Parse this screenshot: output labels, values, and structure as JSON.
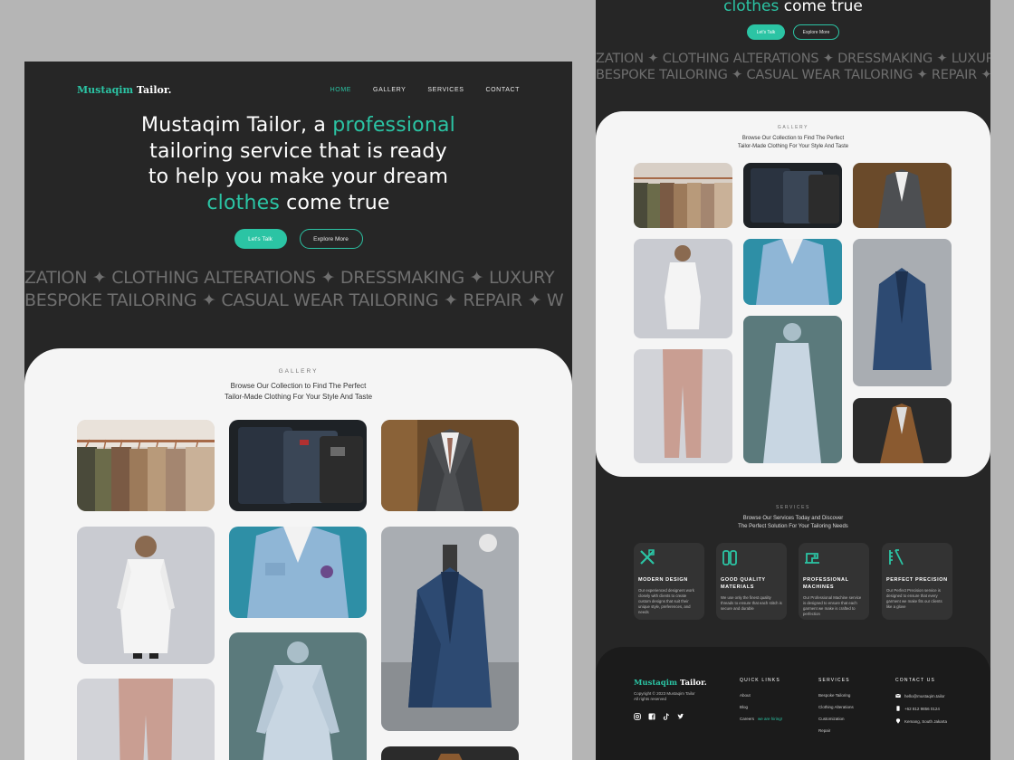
{
  "brand": {
    "name_accent": "Mustaqim",
    "name_rest": " Tailor."
  },
  "nav": {
    "home": "HOME",
    "gallery": "GALLERY",
    "services": "SERVICES",
    "contact": "CONTACT"
  },
  "hero": {
    "line1_a": "Mustaqim Tailor, a ",
    "line1_b": "professional",
    "line2": "tailoring service that is ready",
    "line3": "to help you make your dream",
    "line4_a": "clothes",
    "line4_b": " come true",
    "cta_primary": "Let's Talk",
    "cta_secondary": "Explore More"
  },
  "marquee": {
    "row1": "ZATION ✦ CLOTHING ALTERATIONS ✦ DRESSMAKING ✦ LUXURY",
    "row2": "BESPOKE TAILORING ✦ CASUAL WEAR TAILORING ✦ REPAIR ✦ W"
  },
  "gallery": {
    "label": "GALLERY",
    "subtitle_1": "Browse Our Collection to Find The Perfect",
    "subtitle_2": "Tailor-Made Clothing For Your Style And Taste"
  },
  "services": {
    "label": "SERVICES",
    "subtitle_1": "Browse Our Services Today and Discover",
    "subtitle_2": "The Perfect Solution For Your Tailoring Needs",
    "cards": [
      {
        "icon": "design-tools-icon",
        "title": "MODERN DESIGN",
        "desc": "Our experienced designers work closely with clients to create custom designs that suit their unique style, preferences, and needs"
      },
      {
        "icon": "fabric-icon",
        "title": "GOOD QUALITY MATERIALS",
        "desc": "We use only the finest quality threads to ensure that each stitch is secure and durable"
      },
      {
        "icon": "sewing-machine-icon",
        "title": "PROFESSIONAL MACHINES",
        "desc": "Our Professional Machine service is designed to ensure that each garment we make is crafted to perfection"
      },
      {
        "icon": "measure-icon",
        "title": "PERFECT PRECISION",
        "desc": "Our Perfect Precision service is designed to ensure that every garment we make fits our clients like a glove"
      }
    ]
  },
  "footer": {
    "copyright_1": "Copyright © 2023 Mustaqim Tailor",
    "copyright_2": "All rights reserved",
    "quick_links": {
      "title": "QUICK LINKS",
      "items": [
        "About",
        "Blog",
        "Careers"
      ],
      "careers_tag": "we are hiring!"
    },
    "services": {
      "title": "SERVICES",
      "items": [
        "Bespoke Tailoring",
        "Clothing Alterations",
        "Customization",
        "Repair"
      ]
    },
    "contact": {
      "title": "CONTACT US",
      "email": "hello@mustaqim.tailor",
      "phone": "+62 812 9856 0124",
      "address": "Kemang, South Jakarta"
    }
  },
  "colors": {
    "accent": "#2bc4a4",
    "dark": "#262626",
    "panel": "#f5f5f5",
    "backdrop": "#b5b5b5"
  }
}
